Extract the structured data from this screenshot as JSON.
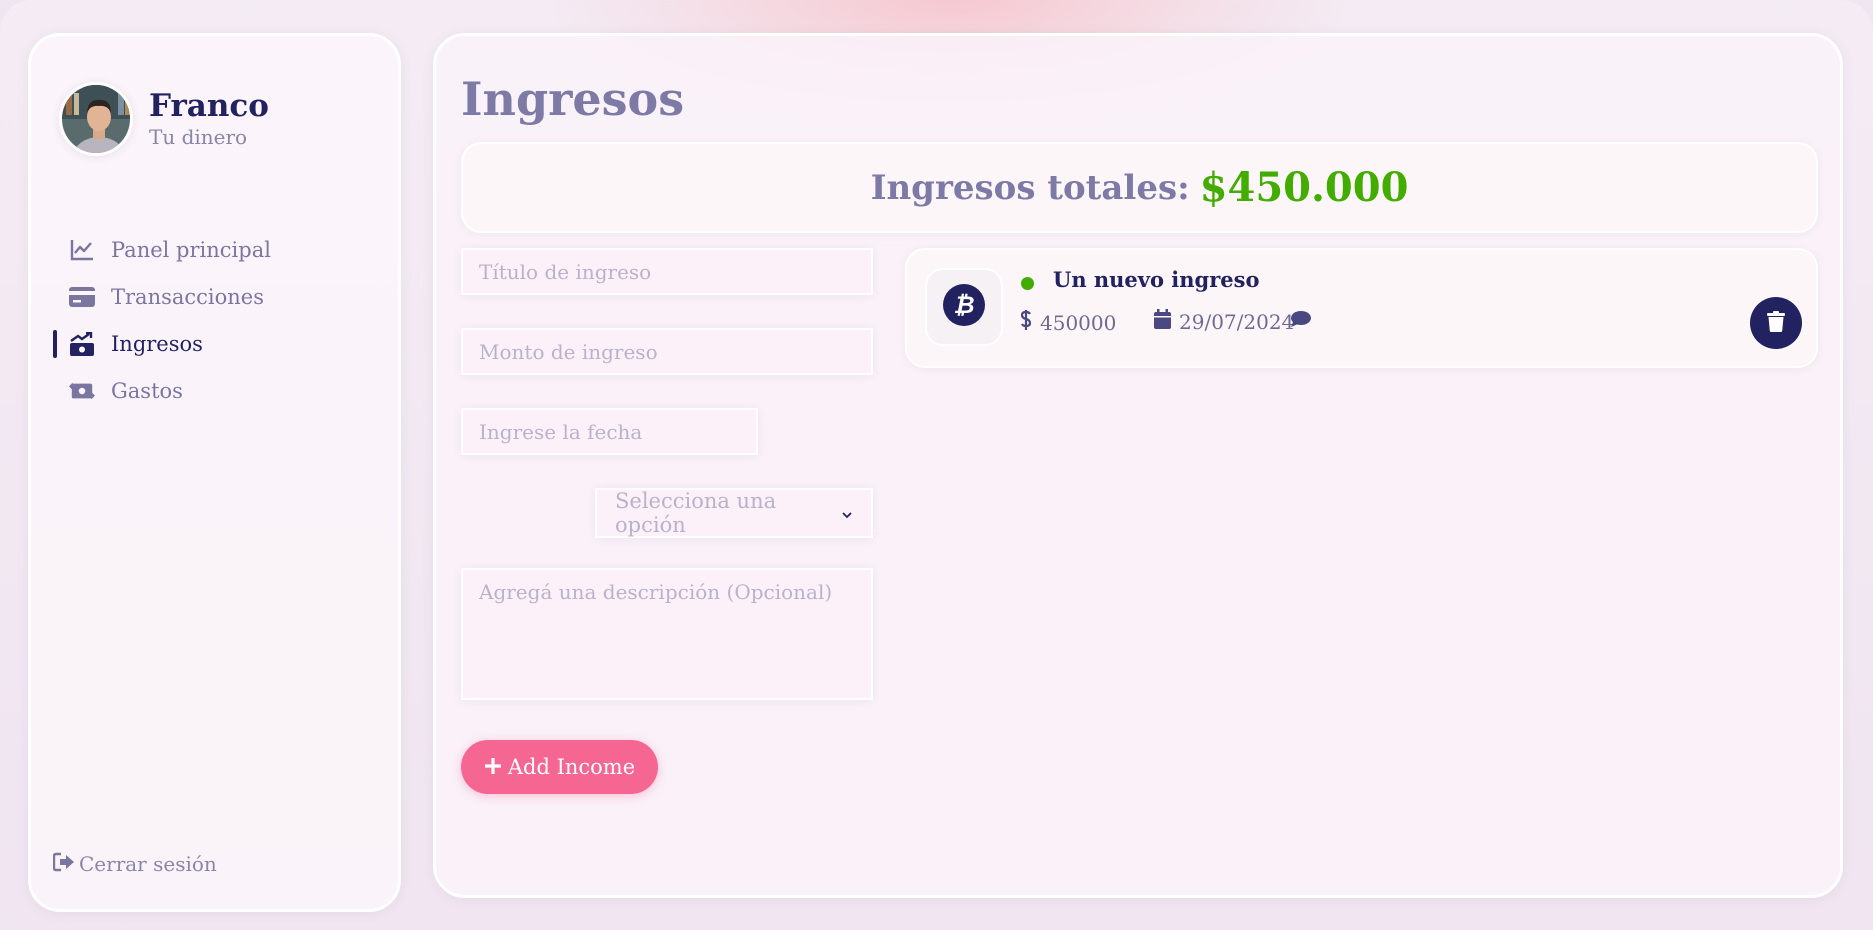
{
  "user": {
    "name": "Franco",
    "subtitle": "Tu dinero"
  },
  "sidebar": {
    "items": [
      {
        "label": "Panel principal",
        "icon": "line-chart-icon",
        "active": false
      },
      {
        "label": "Transacciones",
        "icon": "credit-card-icon",
        "active": false
      },
      {
        "label": "Ingresos",
        "icon": "money-bill-trend-up-icon",
        "active": true
      },
      {
        "label": "Gastos",
        "icon": "money-bill-transfer-icon",
        "active": false
      }
    ],
    "signout_label": "Cerrar sesión"
  },
  "main": {
    "title": "Ingresos",
    "total_label": "Ingresos totales:",
    "total_value": "$450.000"
  },
  "form": {
    "title_placeholder": "Título de ingreso",
    "amount_placeholder": "Monto de ingreso",
    "date_placeholder": "Ingrese la fecha",
    "category_selected": "Selecciona una opción",
    "description_placeholder": "Agregá una descripción (Opcional)",
    "submit_label": "Add Income"
  },
  "incomes": [
    {
      "title": "Un nuevo ingreso",
      "amount": "450000",
      "date": "29/07/2024",
      "category_icon": "bitcoin-icon"
    }
  ],
  "colors": {
    "primary": "#222260",
    "accent": "#f56692",
    "income_green": "#42ad00",
    "muted": "#7e7aa6"
  }
}
